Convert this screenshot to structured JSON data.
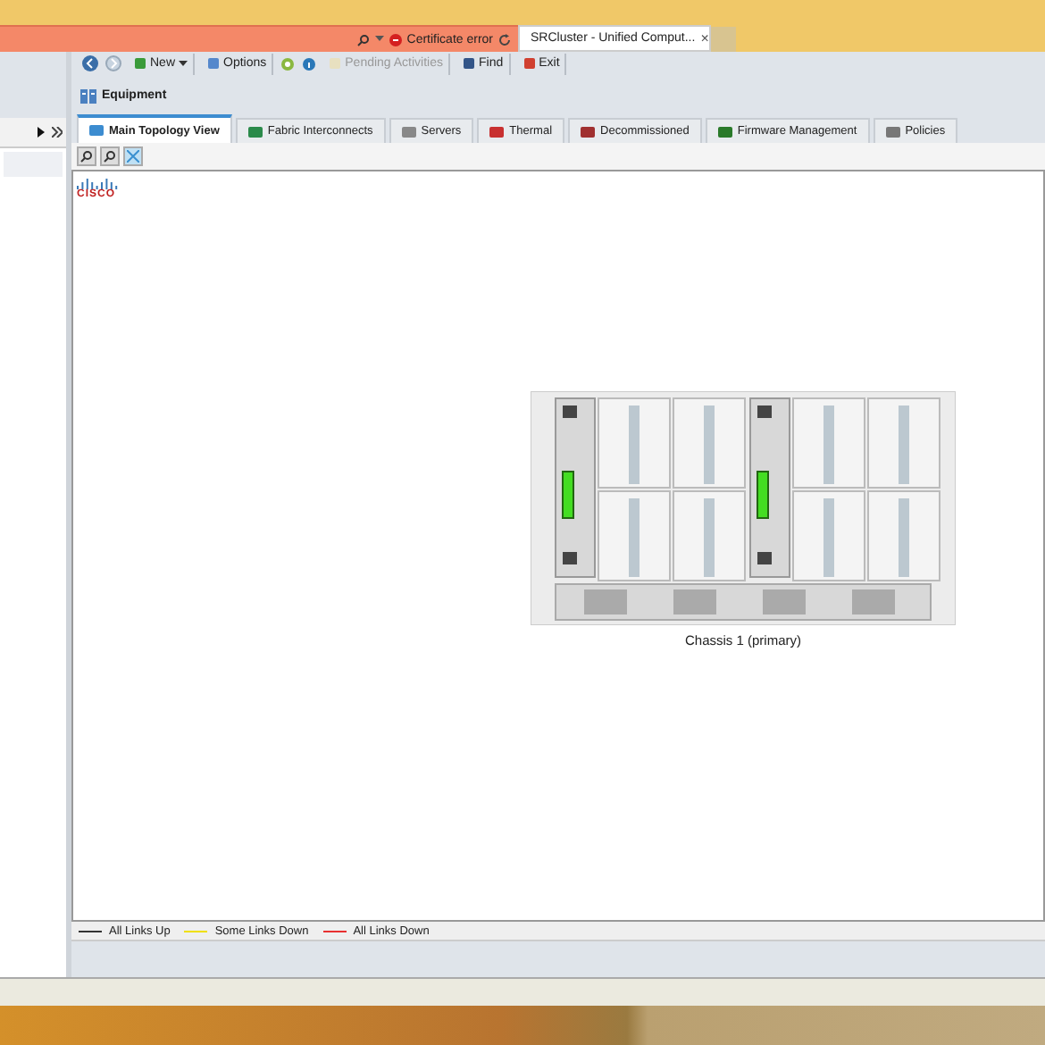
{
  "browser": {
    "address_bar": {
      "certificate_label": "Certificate error"
    },
    "tab": {
      "title": "SRCluster - Unified Comput...",
      "close": "×"
    }
  },
  "toolbar": [
    {
      "label": "New",
      "kind": "menu",
      "disabled": false
    },
    {
      "label": "Options",
      "kind": "button",
      "disabled": false
    },
    {
      "label": "Pending Activities",
      "kind": "button",
      "disabled": true
    },
    {
      "label": "Find",
      "kind": "button",
      "disabled": false
    },
    {
      "label": "Exit",
      "kind": "button",
      "disabled": false
    }
  ],
  "navigation": {
    "section": "Equipment"
  },
  "tabs": [
    {
      "label": "Main Topology View",
      "selected": true
    },
    {
      "label": "Fabric Interconnects",
      "selected": false
    },
    {
      "label": "Servers",
      "selected": false
    },
    {
      "label": "Thermal",
      "selected": false
    },
    {
      "label": "Decommissioned",
      "selected": false
    },
    {
      "label": "Firmware Management",
      "selected": false
    },
    {
      "label": "Policies",
      "selected": false
    }
  ],
  "topology": {
    "logo_text": "CISCO",
    "chassis_label": "Chassis 1 (primary)"
  },
  "legend": [
    {
      "label": "All Links Up",
      "color": "#333333"
    },
    {
      "label": "Some Links Down",
      "color": "#f0e000"
    },
    {
      "label": "All Links Down",
      "color": "#e83030"
    }
  ]
}
